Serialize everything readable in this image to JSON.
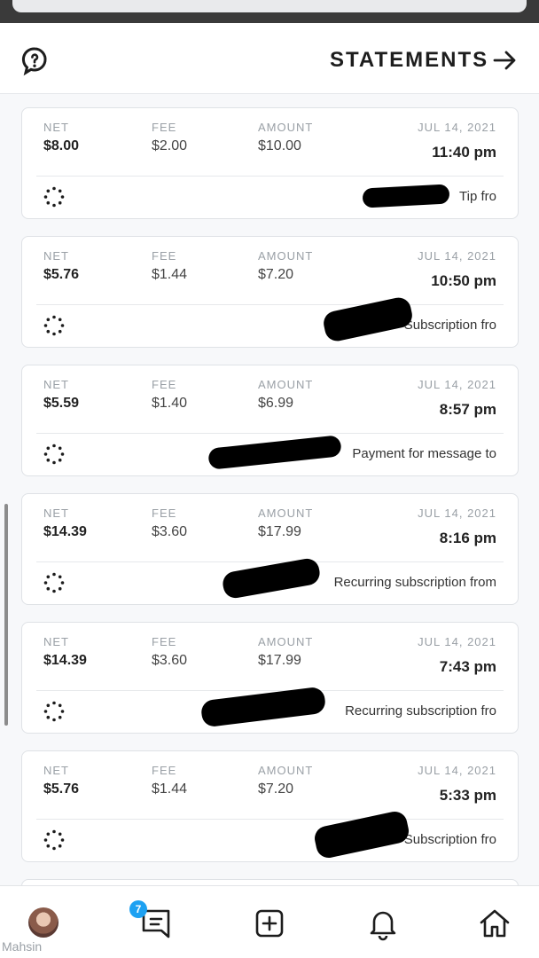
{
  "header": {
    "title": "STATEMENTS",
    "back_icon": "arrow-right-icon",
    "help_icon": "question-icon"
  },
  "statements": [
    {
      "date": "JUL 14, 2021",
      "time": "11:40 pm",
      "amount_label": "AMOUNT",
      "amount": "$10.00",
      "fee_label": "FEE",
      "fee": "$2.00",
      "net_label": "NET",
      "net": "$8.00",
      "description": "Tip fro"
    },
    {
      "date": "JUL 14, 2021",
      "time": "10:50 pm",
      "amount_label": "AMOUNT",
      "amount": "$7.20",
      "fee_label": "FEE",
      "fee": "$1.44",
      "net_label": "NET",
      "net": "$5.76",
      "description": "Subscription fro"
    },
    {
      "date": "JUL 14, 2021",
      "time": "8:57 pm",
      "amount_label": "AMOUNT",
      "amount": "$6.99",
      "fee_label": "FEE",
      "fee": "$1.40",
      "net_label": "NET",
      "net": "$5.59",
      "description": "Payment for message to"
    },
    {
      "date": "JUL 14, 2021",
      "time": "8:16 pm",
      "amount_label": "AMOUNT",
      "amount": "$17.99",
      "fee_label": "FEE",
      "fee": "$3.60",
      "net_label": "NET",
      "net": "$14.39",
      "description": "Recurring subscription from"
    },
    {
      "date": "JUL 14, 2021",
      "time": "7:43 pm",
      "amount_label": "AMOUNT",
      "amount": "$17.99",
      "fee_label": "FEE",
      "fee": "$3.60",
      "net_label": "NET",
      "net": "$14.39",
      "description": "Recurring subscription fro"
    },
    {
      "date": "JUL 14, 2021",
      "time": "5:33 pm",
      "amount_label": "AMOUNT",
      "amount": "$7.20",
      "fee_label": "FEE",
      "fee": "$1.44",
      "net_label": "NET",
      "net": "$5.76",
      "description": "Subscription fro"
    }
  ],
  "bottom_nav": {
    "username": "Mahsin",
    "messages_badge": "7",
    "icons": [
      "avatar",
      "messages-icon",
      "add-icon",
      "bell-icon",
      "home-icon"
    ]
  },
  "colors": {
    "accent": "#1da1f2",
    "muted": "#9aa0a6",
    "text": "#1f1f1f"
  }
}
